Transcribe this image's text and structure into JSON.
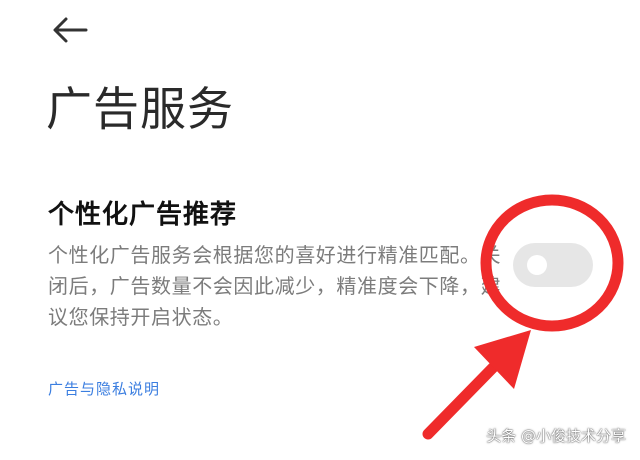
{
  "header": {
    "back_icon": "arrow-left-icon",
    "title": "广告服务"
  },
  "setting": {
    "title": "个性化广告推荐",
    "description": "个性化广告服务会根据您的喜好进行精准匹配。关闭后，广告数量不会因此减少，精准度会下降，建议您保持开启状态。",
    "toggle_state": "off"
  },
  "links": {
    "privacy": "广告与隐私说明"
  },
  "annotation": {
    "shape": "circle-and-arrow",
    "color": "#ef2b2b"
  },
  "watermark": "头条 @小俊技术分享",
  "colors": {
    "background": "#ffffff",
    "title": "#2a2a2a",
    "description": "#7c7c7c",
    "link": "#3b7ee0",
    "toggle_track": "#e6e6e6",
    "annotation": "#ef2b2b"
  }
}
